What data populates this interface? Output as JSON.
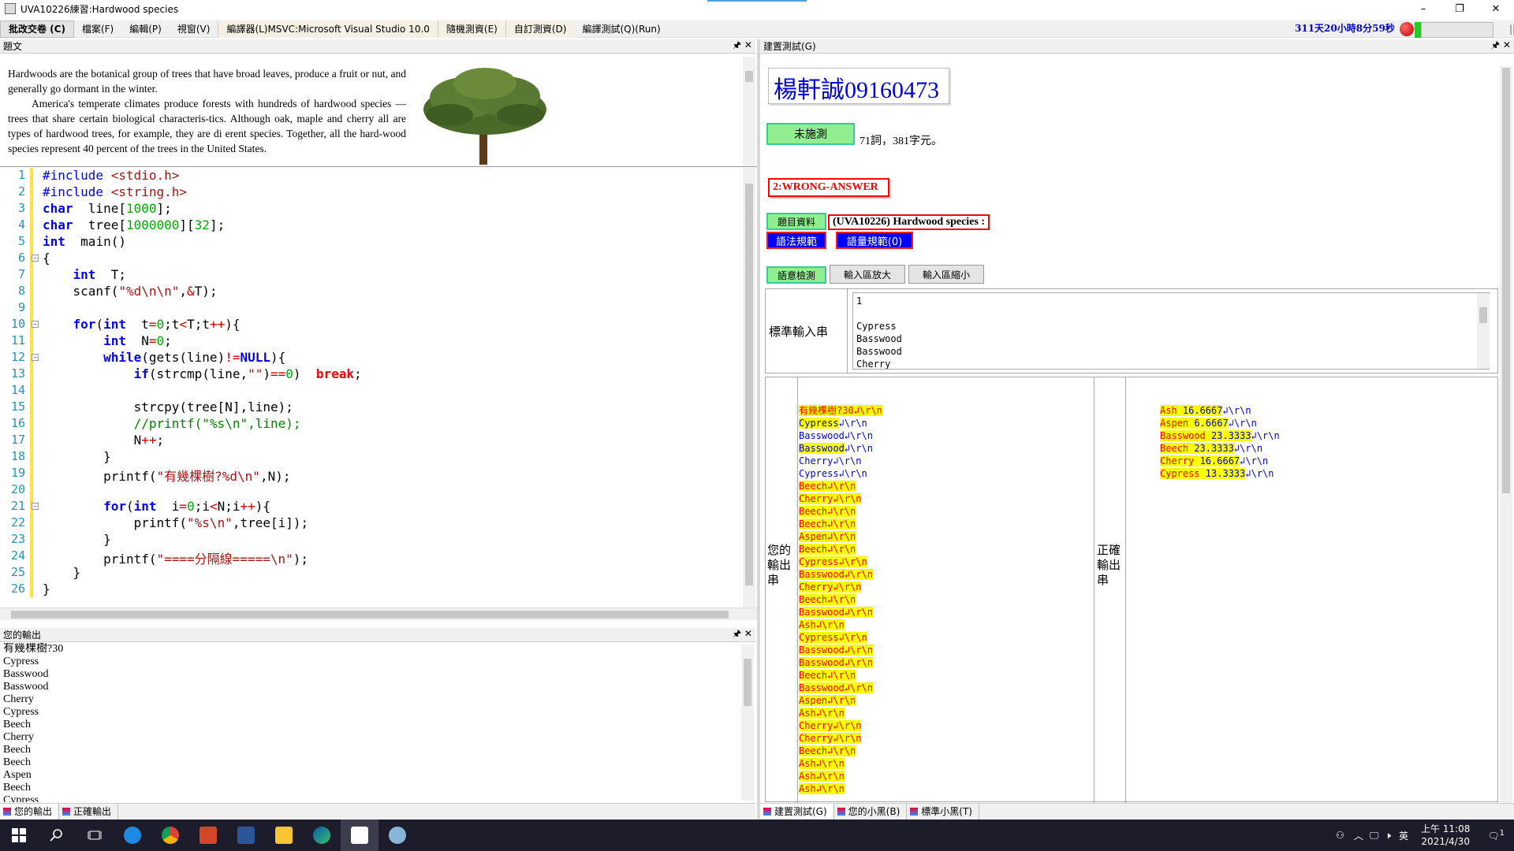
{
  "window": {
    "title": "UVA10226練習:Hardwood species",
    "min": "–",
    "restore": "❐",
    "close": "✕"
  },
  "menu": [
    "批改交卷 (C)",
    "檔案(F)",
    "編輯(P)",
    "視窗(V)",
    "編譯器(L)MSVC:Microsoft Visual Studio 10.0",
    "隨機測資(E)",
    "自訂測資(D)",
    "編譯測試(Q)(Run)"
  ],
  "timer": "311天20小時8分59秒",
  "problem": {
    "header": "題文",
    "paragraphs": [
      "Hardwoods are the botanical group of trees that have broad leaves, produce a fruit or nut, and generally go dormant in the winter.",
      "America's temperate climates produce forests with hundreds of hardwood species —trees that share certain biological characteris-tics. Although oak, maple and cherry all are types of hardwood trees, for example, they are di erent species. Together, all the hard-wood species represent 40 percent of the trees in the United States."
    ]
  },
  "code_lines": [
    [
      [
        "pp",
        "#include "
      ],
      [
        "str",
        "<stdio.h>"
      ]
    ],
    [
      [
        "pp",
        "#include "
      ],
      [
        "str",
        "<string.h>"
      ]
    ],
    [
      [
        "kw",
        "char"
      ],
      [
        "",
        "  line["
      ],
      [
        "num",
        "1000"
      ],
      [
        "",
        "];"
      ]
    ],
    [
      [
        "kw",
        "char"
      ],
      [
        "",
        "  tree["
      ],
      [
        "num",
        "1000000"
      ],
      [
        "",
        "]["
      ],
      [
        "num",
        "32"
      ],
      [
        "",
        "];"
      ]
    ],
    [
      [
        "kw",
        "int"
      ],
      [
        "",
        "  main()"
      ]
    ],
    [
      [
        "",
        "{"
      ]
    ],
    [
      [
        "",
        "    "
      ],
      [
        "kw",
        "int"
      ],
      [
        "",
        "  T;"
      ]
    ],
    [
      [
        "",
        "    scanf("
      ],
      [
        "str",
        "\"%d\\n\\n\""
      ],
      [
        "",
        ","
      ],
      [
        "op",
        "&"
      ],
      [
        "",
        "T);"
      ]
    ],
    [
      [
        "",
        ""
      ]
    ],
    [
      [
        "",
        "    "
      ],
      [
        "kw",
        "for"
      ],
      [
        "",
        "("
      ],
      [
        "kw",
        "int"
      ],
      [
        "",
        "  t"
      ],
      [
        "op",
        "="
      ],
      [
        "num",
        "0"
      ],
      [
        "",
        ";t"
      ],
      [
        "op",
        "<"
      ],
      [
        "",
        "T;t"
      ],
      [
        "op",
        "++"
      ],
      [
        "",
        ")"
      ],
      [
        "",
        "{"
      ]
    ],
    [
      [
        "",
        "        "
      ],
      [
        "kw",
        "int"
      ],
      [
        "",
        "  N"
      ],
      [
        "op",
        "="
      ],
      [
        "num",
        "0"
      ],
      [
        "",
        ";"
      ]
    ],
    [
      [
        "",
        "        "
      ],
      [
        "kw",
        "while"
      ],
      [
        "",
        "(gets(line)"
      ],
      [
        "op",
        "!="
      ],
      [
        "kw",
        "NULL"
      ],
      [
        "",
        ")"
      ],
      [
        "",
        "{"
      ]
    ],
    [
      [
        "",
        "            "
      ],
      [
        "kw",
        "if"
      ],
      [
        "",
        "(strcmp(line,"
      ],
      [
        "str",
        "\"\""
      ],
      [
        "",
        ")"
      ],
      [
        "op",
        "=="
      ],
      [
        "num",
        "0"
      ],
      [
        "",
        ")  "
      ],
      [
        "brk",
        "break"
      ],
      [
        "",
        ";"
      ]
    ],
    [
      [
        "",
        ""
      ]
    ],
    [
      [
        "",
        "            strcpy(tree[N],line);"
      ]
    ],
    [
      [
        "",
        "            "
      ],
      [
        "cmt",
        "//printf(\"%s\\n\",line);"
      ]
    ],
    [
      [
        "",
        "            N"
      ],
      [
        "op",
        "++"
      ],
      [
        "",
        ";"
      ]
    ],
    [
      [
        "",
        "        }"
      ]
    ],
    [
      [
        "",
        "        printf("
      ],
      [
        "str",
        "\"有幾棵樹?%d\\n\""
      ],
      [
        "",
        ",N);"
      ]
    ],
    [
      [
        "",
        ""
      ]
    ],
    [
      [
        "",
        "        "
      ],
      [
        "kw",
        "for"
      ],
      [
        "",
        "("
      ],
      [
        "kw",
        "int"
      ],
      [
        "",
        "  i"
      ],
      [
        "op",
        "="
      ],
      [
        "num",
        "0"
      ],
      [
        "",
        ";i"
      ],
      [
        "op",
        "<"
      ],
      [
        "",
        "N;i"
      ],
      [
        "op",
        "++"
      ],
      [
        "",
        ")"
      ],
      [
        "",
        "{"
      ]
    ],
    [
      [
        "",
        "            printf("
      ],
      [
        "str",
        "\"%s\\n\""
      ],
      [
        "",
        ",tree[i]);"
      ]
    ],
    [
      [
        "",
        "        }"
      ]
    ],
    [
      [
        "",
        "        printf("
      ],
      [
        "str",
        "\"====分隔線=====\\n\""
      ],
      [
        "",
        ");"
      ]
    ],
    [
      [
        "",
        "    }"
      ]
    ],
    [
      [
        "",
        "}"
      ]
    ]
  ],
  "output_panel": {
    "header": "您的輸出",
    "lines": [
      "有幾棵樹?30",
      "Cypress",
      "Basswood",
      "Basswood",
      "Cherry",
      "Cypress",
      "Beech",
      "Cherry",
      "Beech",
      "Beech",
      "Aspen",
      "Beech",
      "Cypress"
    ]
  },
  "bottom_tabs_left": [
    "您的輸出",
    "正確輸出"
  ],
  "bottom_tabs_right": [
    "建置測試(G)",
    "您的小黑(B)",
    "標準小黑(T)"
  ],
  "right": {
    "header": "建置測試(G)",
    "student": "楊軒誠09160473",
    "status_button": "未施測",
    "word_count": "71詞，381字元。",
    "result": "2:WRONG-ANSWER",
    "btn_problem": "題目資料",
    "problem_title": "(UVA10226) Hardwood species :",
    "btn_syntax": "語法規範",
    "btn_quantity": "語量規範(0)",
    "btn_semantic": "語意檢測",
    "btn_zoom_in": "輸入區放大",
    "btn_zoom_out": "輸入區縮小",
    "stdin_label": "標準輸入串",
    "stdin_lines": [
      "1",
      "",
      "Cypress",
      "Basswood",
      "Basswood",
      "Cherry"
    ],
    "your_output_label": "您的輸出串",
    "correct_output_label": "正確輸出串",
    "your_output": [
      {
        "t": "有幾棵樹?30",
        "s": "↲\\r\\n",
        "k": "bad"
      },
      {
        "t": "Cypress",
        "s": "↲\\r\\n",
        "k": "mix"
      },
      {
        "t": "Basswood",
        "s": "↲\\r\\n",
        "k": "good"
      },
      {
        "t": "Basswood",
        "s": "↲\\r\\n",
        "k": "mix"
      },
      {
        "t": "Cherry",
        "s": "↲\\r\\n",
        "k": "good"
      },
      {
        "t": "Cypress",
        "s": "↲\\r\\n",
        "k": "good"
      },
      {
        "t": "Beech",
        "s": "↲\\r\\n",
        "k": "bad"
      },
      {
        "t": "Cherry",
        "s": "↲\\r\\n",
        "k": "bad"
      },
      {
        "t": "Beech",
        "s": "↲\\r\\n",
        "k": "bad"
      },
      {
        "t": "Beech",
        "s": "↲\\r\\n",
        "k": "bad"
      },
      {
        "t": "Aspen",
        "s": "↲\\r\\n",
        "k": "bad"
      },
      {
        "t": "Beech",
        "s": "↲\\r\\n",
        "k": "bad"
      },
      {
        "t": "Cypress",
        "s": "↲\\r\\n",
        "k": "bad"
      },
      {
        "t": "Basswood",
        "s": "↲\\r\\n",
        "k": "bad"
      },
      {
        "t": "Cherry",
        "s": "↲\\r\\n",
        "k": "bad"
      },
      {
        "t": "Beech",
        "s": "↲\\r\\n",
        "k": "bad"
      },
      {
        "t": "Basswood",
        "s": "↲\\r\\n",
        "k": "bad"
      },
      {
        "t": "Ash",
        "s": "↲\\r\\n",
        "k": "bad"
      },
      {
        "t": "Cypress",
        "s": "↲\\r\\n",
        "k": "bad"
      },
      {
        "t": "Basswood",
        "s": "↲\\r\\n",
        "k": "bad"
      },
      {
        "t": "Basswood",
        "s": "↲\\r\\n",
        "k": "bad"
      },
      {
        "t": "Beech",
        "s": "↲\\r\\n",
        "k": "bad"
      },
      {
        "t": "Basswood",
        "s": "↲\\r\\n",
        "k": "bad"
      },
      {
        "t": "Aspen",
        "s": "↲\\r\\n",
        "k": "bad"
      },
      {
        "t": "Ash",
        "s": "↲\\r\\n",
        "k": "bad"
      },
      {
        "t": "Cherry",
        "s": "↲\\r\\n",
        "k": "bad"
      },
      {
        "t": "Cherry",
        "s": "↲\\r\\n",
        "k": "bad"
      },
      {
        "t": "Beech",
        "s": "↲\\r\\n",
        "k": "bad"
      },
      {
        "t": "Ash",
        "s": "↲\\r\\n",
        "k": "bad"
      },
      {
        "t": "Ash",
        "s": "↲\\r\\n",
        "k": "bad"
      },
      {
        "t": "Ash",
        "s": "↲\\r\\n",
        "k": "bad"
      }
    ],
    "correct_output": [
      {
        "a": "Ash",
        "b": " 16.6667",
        "s": "↲\\r\\n"
      },
      {
        "a": "Aspen",
        "b": " 6.6667",
        "s": "↲\\r\\n"
      },
      {
        "a": "Basswood",
        "b": " 23.3333",
        "s": "↲\\r\\n"
      },
      {
        "a": "Beech",
        "b": " 23.3333",
        "s": "↲\\r\\n"
      },
      {
        "a": "Cherry",
        "b": " 16.6667",
        "s": "↲\\r\\n"
      },
      {
        "a": "Cypress",
        "b": " 13.3333",
        "s": "↲\\r\\n"
      }
    ]
  },
  "tray": {
    "time": "上午 11:08",
    "date": "2021/4/30",
    "ime": "英",
    "notif": "1"
  },
  "colors": {
    "accent_blue": "#0000ff",
    "wrong_red": "#ff0000",
    "green_btn": "#90ee90",
    "highlight": "#ffff00"
  }
}
